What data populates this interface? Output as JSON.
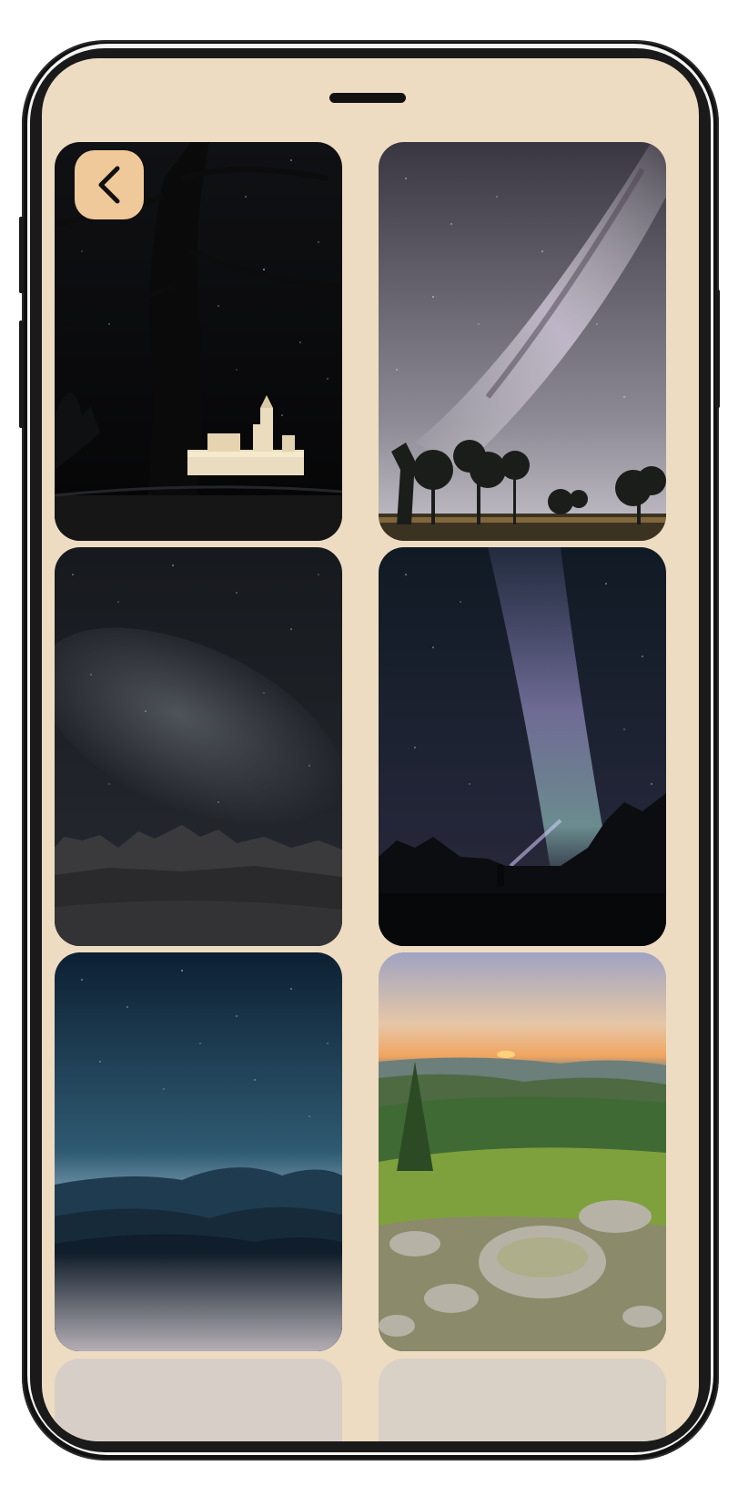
{
  "app": {
    "screen_background": "#eedcc2",
    "accent_color": "#f0c99a"
  },
  "navigation": {
    "back_icon": "chevron-left-icon"
  },
  "gallery": {
    "items": [
      {
        "id": "castle-night",
        "alt": "Castle at night under starry sky"
      },
      {
        "id": "milky-way-trees",
        "alt": "Milky Way over silhouetted trees"
      },
      {
        "id": "rocky-starfield",
        "alt": "Starry sky over rocky ridge"
      },
      {
        "id": "milky-way-hiker",
        "alt": "Milky Way with hiker headlamp"
      },
      {
        "id": "blue-mountains",
        "alt": "Blue mountains under starry sky"
      },
      {
        "id": "green-sunrise",
        "alt": "Sunrise over green forested hills"
      }
    ]
  }
}
